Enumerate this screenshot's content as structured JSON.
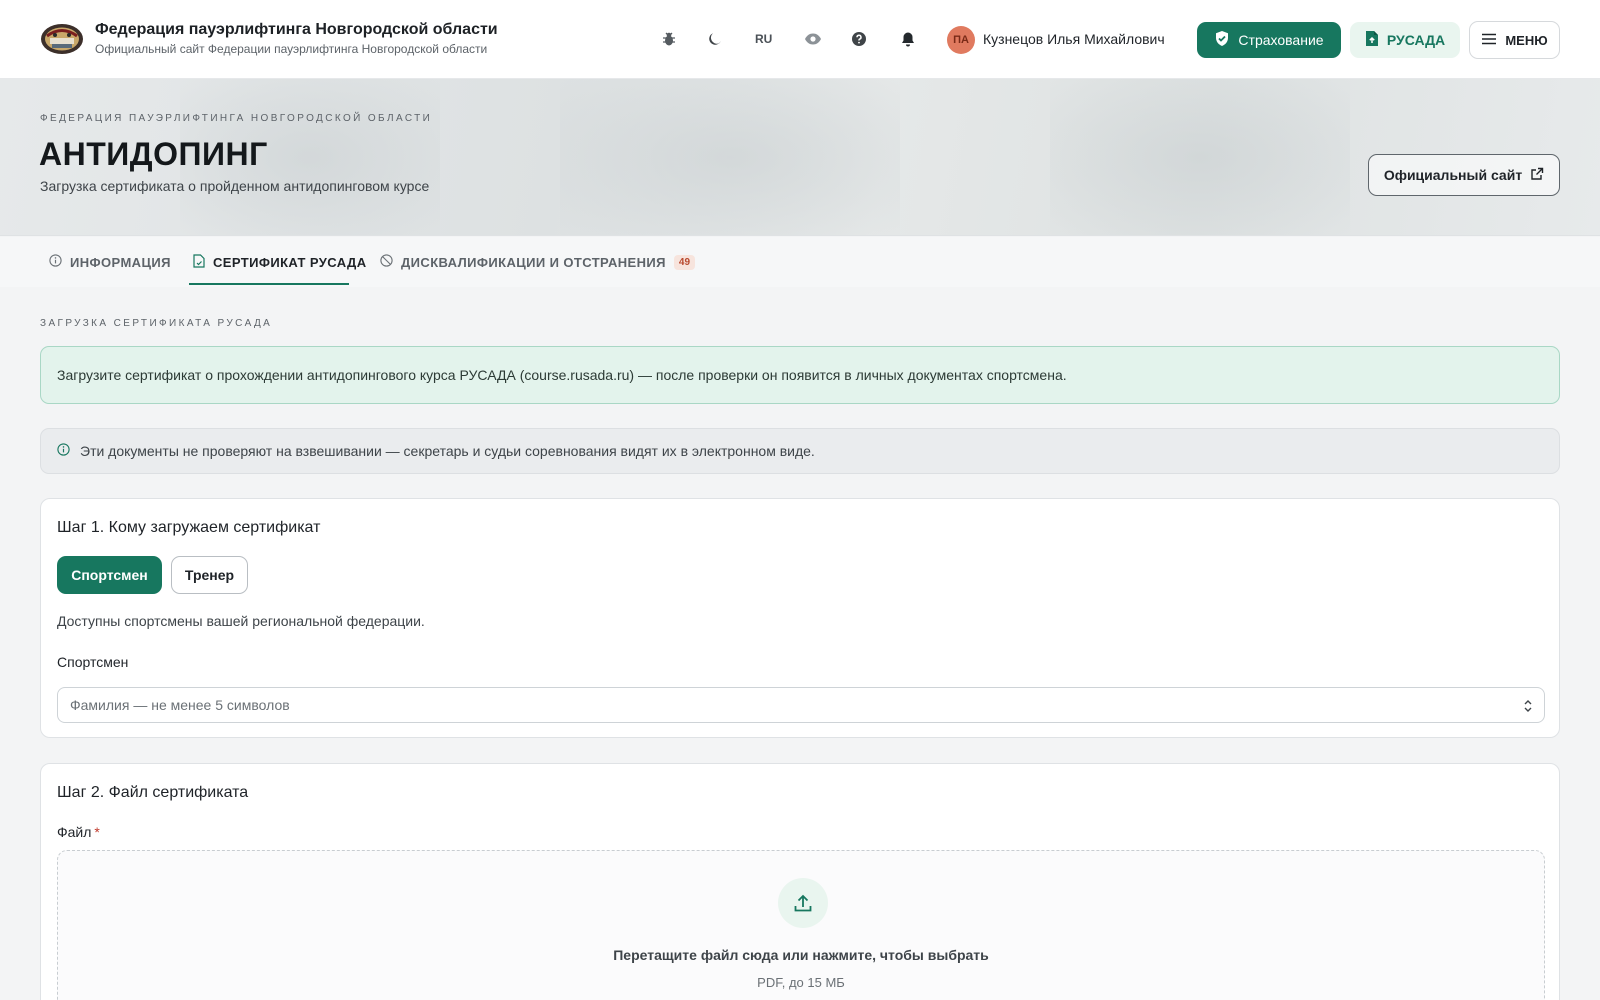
{
  "header": {
    "org_title": "Федерация пауэрлифтинга Новгородской области",
    "org_subtitle": "Официальный сайт Федерации пауэрлифтинга Новгородской области",
    "lang": "RU",
    "user_initials": "ПА",
    "user_name": "Кузнецов Илья Михайлович",
    "insurance_label": "Страхование",
    "rusada_label": "РУСАДА",
    "menu_label": "МЕНЮ",
    "icons": [
      "bug-icon",
      "moon-icon",
      "eye-icon",
      "help-icon",
      "bell-icon"
    ]
  },
  "hero": {
    "kicker": "ФЕДЕРАЦИЯ ПАУЭРЛИФТИНГА НОВГОРОДСКОЙ ОБЛАСТИ",
    "title": "АНТИДОПИНГ",
    "subtitle": "Загрузка сертификата о пройденном антидопинговом курсе",
    "official_site_label": "Официальный сайт"
  },
  "tabs": [
    {
      "label": "ИНФОРМАЦИЯ",
      "icon": "info-icon",
      "active": false
    },
    {
      "label": "СЕРТИФИКАТ РУСАДА",
      "icon": "document-icon",
      "active": true
    },
    {
      "label": "ДИСКВАЛИФИКАЦИИ И ОТСТРАНЕНИЯ",
      "icon": "ban-icon",
      "active": false,
      "count": "49"
    }
  ],
  "main": {
    "section_label": "ЗАГРУЗКА СЕРТИФИКАТА РУСАДА",
    "notice_green": "Загрузите сертификат о прохождении антидопингового курса РУСАДА (course.rusada.ru) — после проверки он появится в личных документах спортсмена.",
    "notice_gray": "Эти документы не проверяют на взвешивании — секретарь и судьи соревнования видят их в электронном виде.",
    "step1": {
      "title": "Шаг 1. Кому загружаем сертификат",
      "option_athlete": "Спортсмен",
      "option_coach": "Тренер",
      "hint": "Доступны спортсмены вашей региональной федерации.",
      "field_label": "Спортсмен",
      "placeholder": "Фамилия — не менее 5 символов"
    },
    "step2": {
      "title": "Шаг 2. Файл сертификата",
      "field_label": "Файл",
      "required_mark": "*",
      "drop_title": "Перетащите файл сюда или нажмите, чтобы выбрать",
      "drop_sub": "PDF, до 15 МБ"
    }
  },
  "colors": {
    "accent": "#17775f",
    "accent_light": "#e9f5ef",
    "notice_green_bg": "#e3f3ec",
    "badge_bg": "#f7e4dd",
    "badge_text": "#b8492e"
  }
}
